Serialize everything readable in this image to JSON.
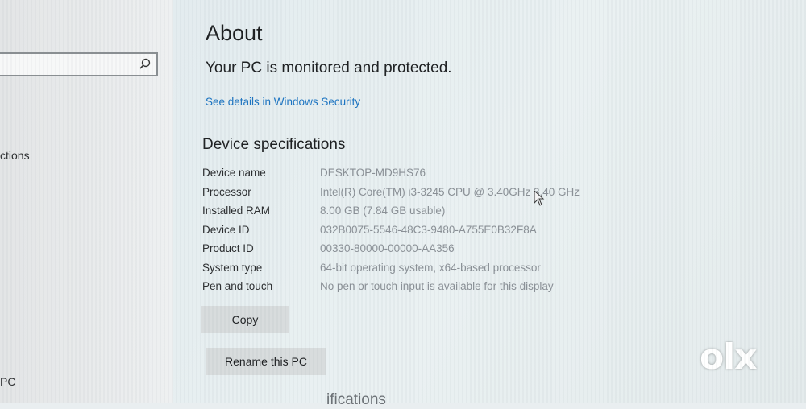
{
  "sidebar": {
    "search": {
      "placeholder": ""
    },
    "items": [
      {
        "label": "ctions"
      },
      {
        "label": "PC"
      }
    ]
  },
  "main": {
    "title": "About",
    "protection_message": "Your PC is monitored and protected.",
    "security_link": "See details in Windows Security",
    "device_specs": {
      "title": "Device specifications",
      "rows": [
        {
          "label": "Device name",
          "value": "DESKTOP-MD9HS76"
        },
        {
          "label": "Processor",
          "value": "Intel(R) Core(TM) i3-3245 CPU @ 3.40GHz   3.40 GHz"
        },
        {
          "label": "Installed RAM",
          "value": "8.00 GB (7.84 GB usable)"
        },
        {
          "label": "Device ID",
          "value": "032B0075-5546-48C3-9480-A755E0B32F8A"
        },
        {
          "label": "Product ID",
          "value": "00330-80000-00000-AA356"
        },
        {
          "label": "System type",
          "value": "64-bit operating system, x64-based processor"
        },
        {
          "label": "Pen and touch",
          "value": "No pen or touch input is available for this display"
        }
      ]
    },
    "copy_button": "Copy",
    "rename_button": "Rename this PC",
    "partial_heading": "ifications"
  },
  "watermark": {
    "text": "olx"
  },
  "colors": {
    "link": "#1b74c2",
    "value_text": "#8a9096"
  },
  "icons": {
    "search": "search-icon",
    "cursor": "mouse-pointer-icon"
  }
}
